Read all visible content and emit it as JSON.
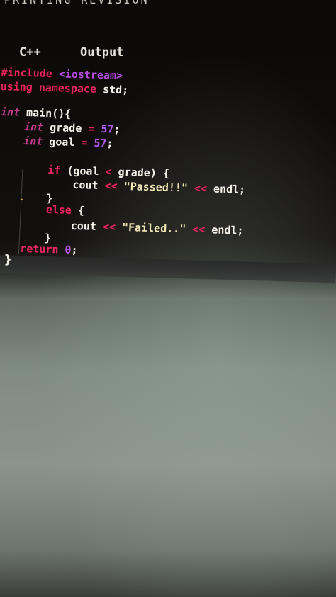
{
  "top_text": "PRINTING REVISION",
  "tabs": [
    {
      "label": "C++"
    },
    {
      "label": "Output"
    }
  ],
  "code": {
    "line1": {
      "directive": "#include",
      "header": "<iostream>"
    },
    "line2": {
      "kw1": "using",
      "kw2": "namespace",
      "name": "std",
      "end": ";"
    },
    "line3": {
      "type": "int",
      "name": "main",
      "rest": "(){"
    },
    "line4": {
      "type": "int",
      "name": "grade",
      "op": "=",
      "value": "57",
      "end": ";"
    },
    "line5": {
      "type": "int",
      "name": "goal",
      "op": "=",
      "value": "57",
      "end": ";"
    },
    "line6": {
      "kw": "if",
      "open": "(",
      "a": "goal",
      "op": "<",
      "b": "grade",
      "close": ") {"
    },
    "line7": {
      "fn": "cout",
      "op1": "<<",
      "str": "\"Passed!!\"",
      "op2": "<<",
      "endl": "endl",
      "end": ";"
    },
    "line8": {
      "brace": "}"
    },
    "line9": {
      "kw": "else",
      "brace": "{"
    },
    "line10": {
      "fn": "cout",
      "op1": "<<",
      "str": "\"Failed..\"",
      "op2": "<<",
      "endl": "endl",
      "end": ";"
    },
    "line11": {
      "brace": "}"
    },
    "line12": {
      "kw": "return",
      "value": "0",
      "end": ";"
    },
    "line13": {
      "brace": "}"
    }
  },
  "colors": {
    "keyword": "#f0245f",
    "number": "#b75af2",
    "string": "#f2e8b8",
    "identifier": "#f5f0e8",
    "header": "#b84bdf"
  }
}
